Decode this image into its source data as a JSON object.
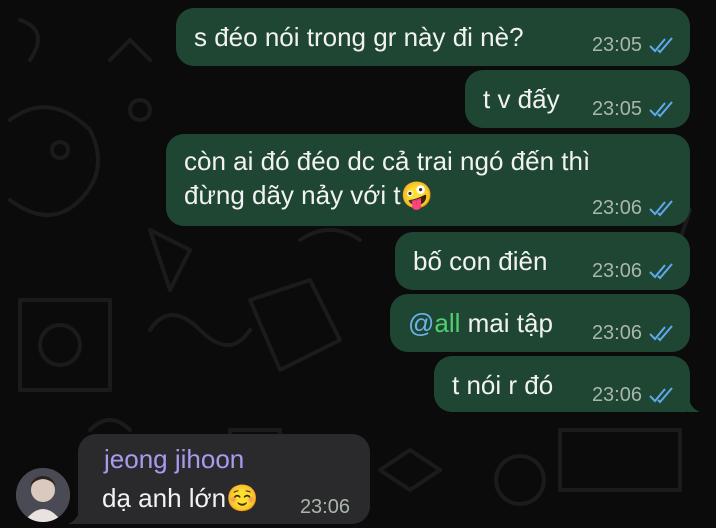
{
  "colors": {
    "background": "#0b0b0b",
    "outgoing_bubble": "#1f4632",
    "incoming_bubble": "#2a2a2c",
    "ticks": "#5ea8ec",
    "sender_name": "#a99af0",
    "mention_all": "#4fcf6f"
  },
  "messages": [
    {
      "text": "s đéo nói trong gr này đi nè?",
      "time": "23:05",
      "status_icon": "double-check-icon"
    },
    {
      "text": "t v đấy",
      "time": "23:05",
      "status_icon": "double-check-icon"
    },
    {
      "line1": "còn ai đó đéo dc cả trai ngó đến thì",
      "line2": "đừng dãy nảy với t",
      "emoji": "🤪",
      "time": "23:06",
      "status_icon": "double-check-icon"
    },
    {
      "text": "bố con điên",
      "time": "23:06",
      "status_icon": "double-check-icon"
    },
    {
      "mention": "@",
      "mention_word": "all",
      "rest": " mai tập",
      "time": "23:06",
      "status_icon": "double-check-icon"
    },
    {
      "text": "t nói r đó",
      "time": "23:06",
      "status_icon": "double-check-icon"
    }
  ],
  "incoming": {
    "sender": "jeong jihoon",
    "text": "dạ anh lớn",
    "emoji": "☺️",
    "time": "23:06"
  }
}
